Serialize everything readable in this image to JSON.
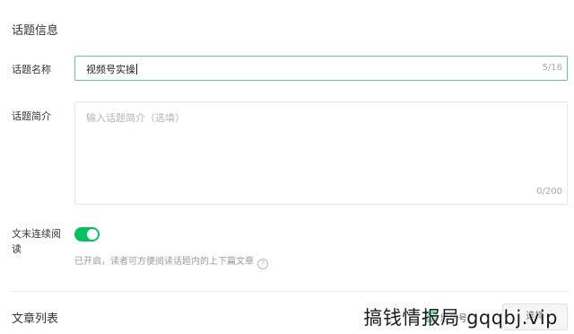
{
  "section": {
    "title": "话题信息"
  },
  "name_field": {
    "label": "话题名称",
    "value": "视频号实操",
    "counter": "5/16"
  },
  "intro_field": {
    "label": "话题简介",
    "placeholder": "输入话题简介（选填）",
    "counter": "0/200"
  },
  "continuous_read": {
    "label_line1": "文末连续阅",
    "label_line2": "读",
    "enabled": true,
    "hint": "已开启，读者可方便阅读话题内的上下篇文章"
  },
  "article_list": {
    "title": "文章列表",
    "sort_label": "题序号",
    "select_label": "选择"
  },
  "watermark": "搞钱情报局 gqqbj.vip",
  "colors": {
    "accent": "#07c160",
    "focus_border": "#62c3a8"
  }
}
